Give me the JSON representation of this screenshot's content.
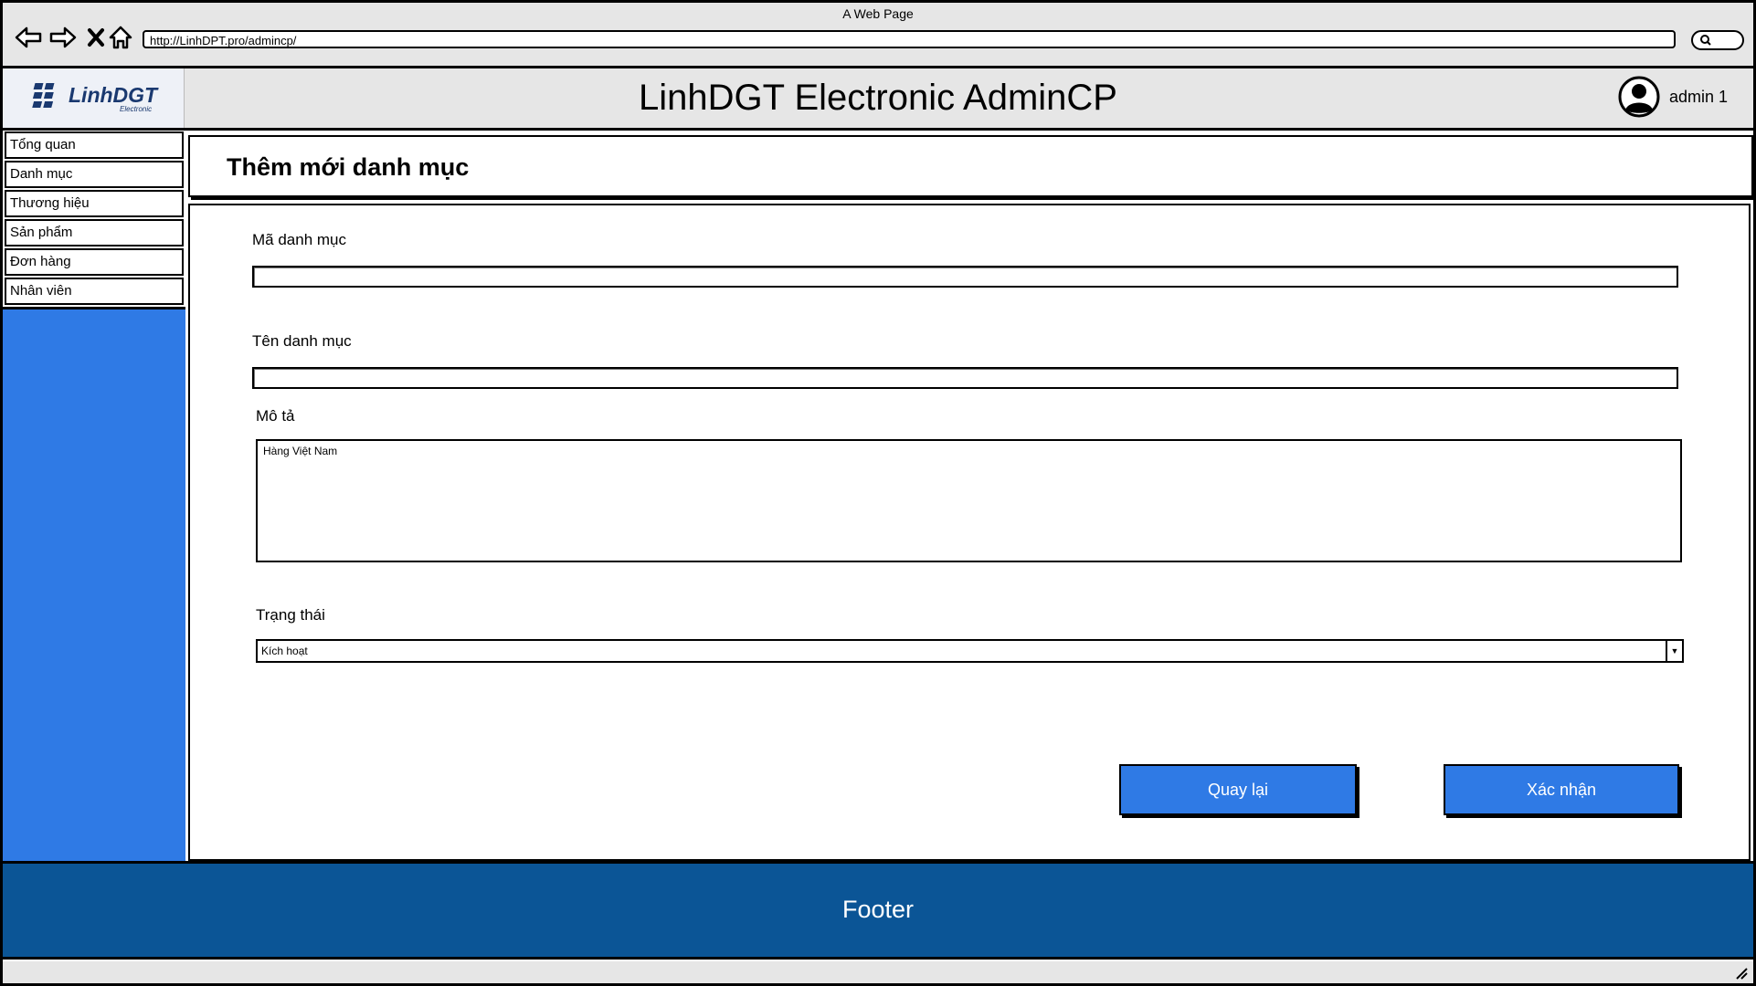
{
  "browser": {
    "window_title": "A Web Page",
    "url": "http://LinhDPT.pro/admincp/"
  },
  "header": {
    "logo_name": "LinhDGT",
    "logo_sub": "Electronic",
    "app_title": "LinhDGT Electronic AdminCP",
    "user_name": "admin 1"
  },
  "sidebar": {
    "items": [
      {
        "label": "Tổng quan"
      },
      {
        "label": "Danh mục"
      },
      {
        "label": "Thương hiệu"
      },
      {
        "label": "Sản phẩm"
      },
      {
        "label": "Đơn hàng"
      },
      {
        "label": "Nhân viên"
      }
    ]
  },
  "page": {
    "title": "Thêm mới danh mục"
  },
  "form": {
    "code_label": "Mã danh mục",
    "code_value": "",
    "name_label": "Tên danh mục",
    "name_value": "",
    "desc_label": "Mô tả",
    "desc_value": "Hàng Việt Nam",
    "status_label": "Trạng thái",
    "status_value": "Kích hoạt",
    "back_label": "Quay lại",
    "confirm_label": "Xác  nhận"
  },
  "footer": {
    "text": "Footer"
  },
  "colors": {
    "sidebar": "#2f7ae5",
    "button": "#2f7ae5",
    "footer": "#0b5596",
    "chrome": "#e6e6e6"
  }
}
